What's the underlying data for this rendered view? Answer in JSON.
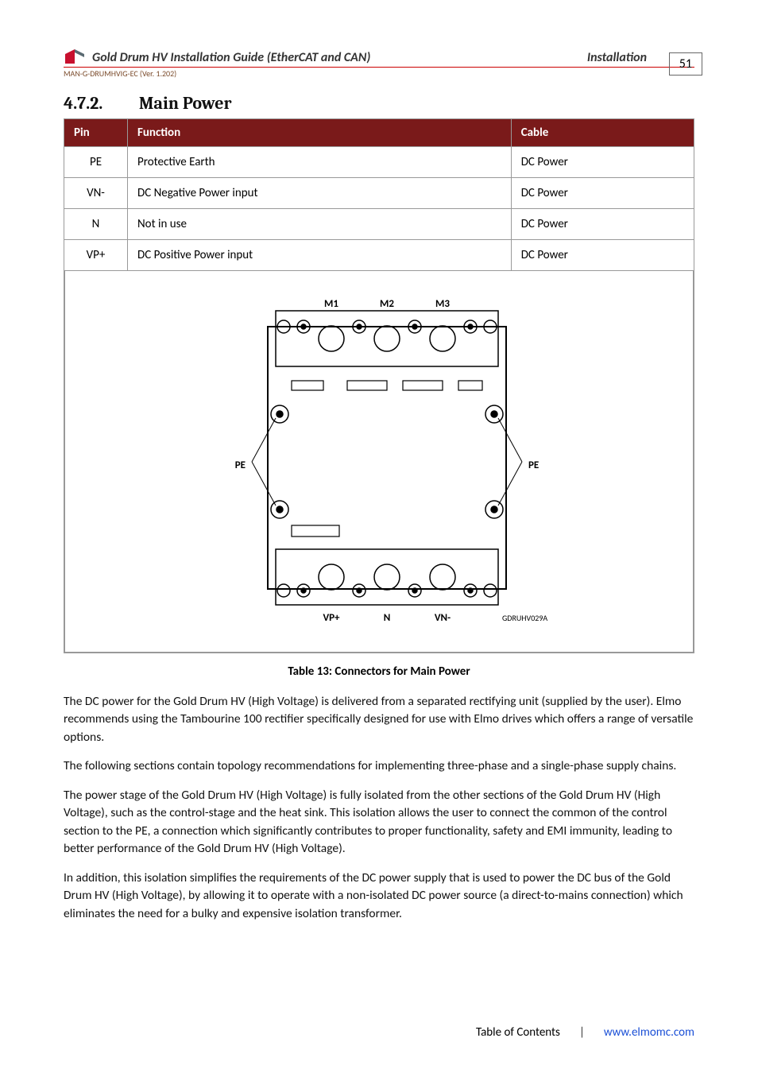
{
  "header": {
    "doc_title": "Gold Drum HV Installation Guide (EtherCAT and CAN)",
    "section": "Installation",
    "man_code": "MAN-G-DRUMHVIG-EC (Ver. 1.202)",
    "page_number": "51"
  },
  "heading": {
    "number": "4.7.2.",
    "title": "Main Power"
  },
  "table": {
    "headers": {
      "pin": "Pin",
      "function": "Function",
      "cable": "Cable"
    },
    "rows": [
      {
        "pin": "PE",
        "function": "Protective Earth",
        "cable": "DC Power"
      },
      {
        "pin": "VN-",
        "function": "DC Negative Power input",
        "cable": "DC Power"
      },
      {
        "pin": "N",
        "function": "Not in use",
        "cable": "DC Power"
      },
      {
        "pin": "VP+",
        "function": "DC Positive Power input",
        "cable": "DC Power"
      }
    ]
  },
  "figure": {
    "labels": {
      "m1": "M1",
      "m2": "M2",
      "m3": "M3",
      "pe_left": "PE",
      "pe_right": "PE",
      "vp_plus": "VP+",
      "n": "N",
      "vn_minus": "VN-",
      "drawing_code": "GDRUHV029A"
    }
  },
  "caption": "Table 13: Connectors for Main Power",
  "paragraphs": {
    "p1": "The DC power for the Gold Drum HV (High Voltage) is delivered from a separated rectifying unit (supplied by the user). Elmo recommends using the Tambourine 100 rectifier specifically designed for use with Elmo drives which offers a range of versatile options.",
    "p2": "The following sections contain topology recommendations for implementing three-phase and a single-phase supply chains.",
    "p3": "The power stage of the Gold Drum HV (High Voltage) is fully isolated from the other sections of the Gold Drum HV (High Voltage), such as the control-stage and the heat sink. This isolation allows the user to connect the common of the control section to the PE, a connection which significantly contributes to proper functionality, safety and EMI immunity, leading to better performance of the Gold Drum HV (High Voltage).",
    "p4": "In addition, this isolation simplifies the requirements of the DC power supply that is used to power the DC bus of the Gold Drum HV (High Voltage), by allowing it to operate with a non-isolated DC power source (a direct-to-mains connection) which eliminates the need for a bulky and expensive isolation transformer."
  },
  "footer": {
    "toc": "Table of Contents",
    "url": "www.elmomc.com"
  }
}
